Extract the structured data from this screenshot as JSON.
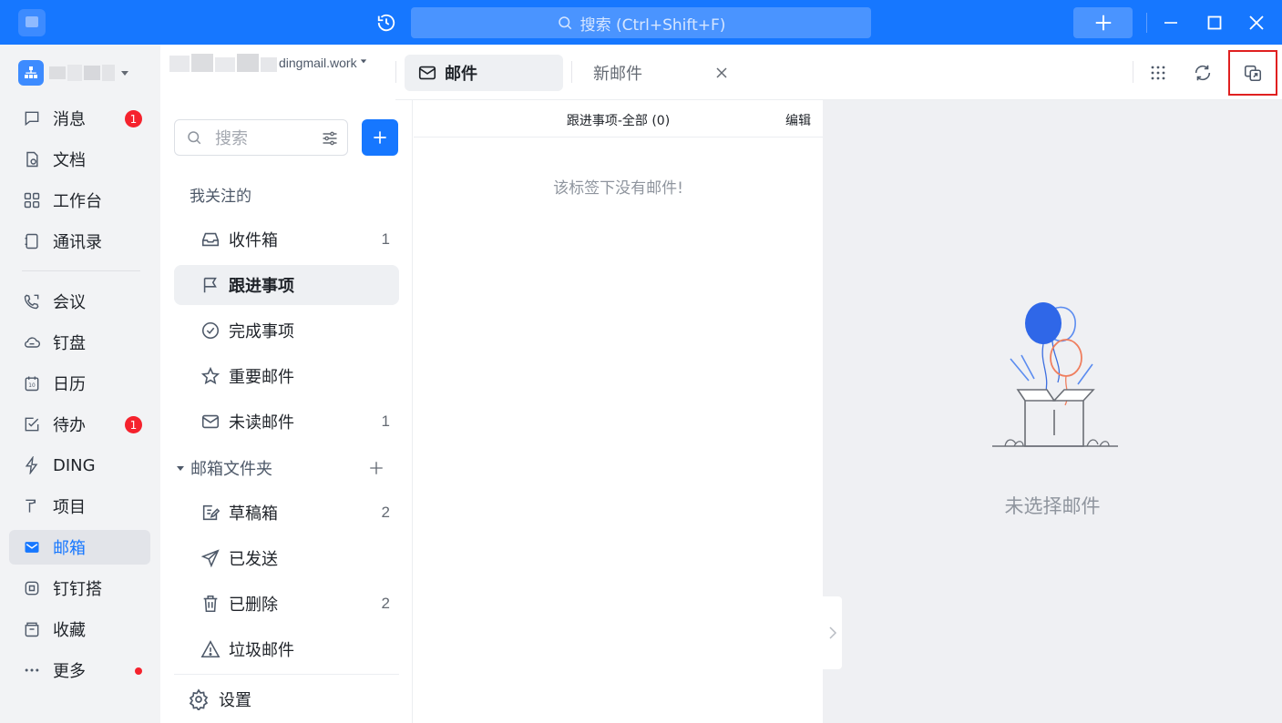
{
  "titlebar": {
    "search_placeholder": "搜索 (Ctrl+Shift+F)",
    "accent_color": "#1677ff"
  },
  "account": {
    "email_suffix": "dingmail.work"
  },
  "nav": {
    "items": [
      {
        "label": "消息",
        "icon": "message-icon",
        "badge": "1"
      },
      {
        "label": "文档",
        "icon": "document-icon"
      },
      {
        "label": "工作台",
        "icon": "workbench-icon"
      },
      {
        "label": "通讯录",
        "icon": "contacts-icon"
      },
      {
        "label": "会议",
        "icon": "meeting-icon"
      },
      {
        "label": "钉盘",
        "icon": "cloud-drive-icon"
      },
      {
        "label": "日历",
        "icon": "calendar-icon"
      },
      {
        "label": "待办",
        "icon": "todo-icon",
        "badge": "1"
      },
      {
        "label": "DING",
        "icon": "ding-icon"
      },
      {
        "label": "项目",
        "icon": "project-icon"
      },
      {
        "label": "邮箱",
        "icon": "mail-icon",
        "active": true
      },
      {
        "label": "钉钉搭",
        "icon": "builder-icon"
      },
      {
        "label": "收藏",
        "icon": "favorites-icon"
      },
      {
        "label": "更多",
        "icon": "more-icon",
        "dot": true
      }
    ]
  },
  "folders": {
    "search_placeholder": "搜索",
    "followed_heading": "我关注的",
    "followed": [
      {
        "label": "收件箱",
        "count": "1"
      },
      {
        "label": "跟进事项",
        "count": ""
      },
      {
        "label": "完成事项",
        "count": ""
      },
      {
        "label": "重要邮件",
        "count": ""
      },
      {
        "label": "未读邮件",
        "count": "1"
      }
    ],
    "mailbox_section": "邮箱文件夹",
    "mailbox": [
      {
        "label": "草稿箱",
        "count": "2"
      },
      {
        "label": "已发送",
        "count": ""
      },
      {
        "label": "已删除",
        "count": "2"
      },
      {
        "label": "垃圾邮件",
        "count": ""
      }
    ],
    "settings_label": "设置"
  },
  "tabs": {
    "mail_tab": "邮件",
    "new_mail_tab": "新邮件"
  },
  "maillist": {
    "title": "跟进事项-全部 (0)",
    "edit": "编辑",
    "empty": "该标签下没有邮件!"
  },
  "reader": {
    "empty": "未选择邮件"
  }
}
